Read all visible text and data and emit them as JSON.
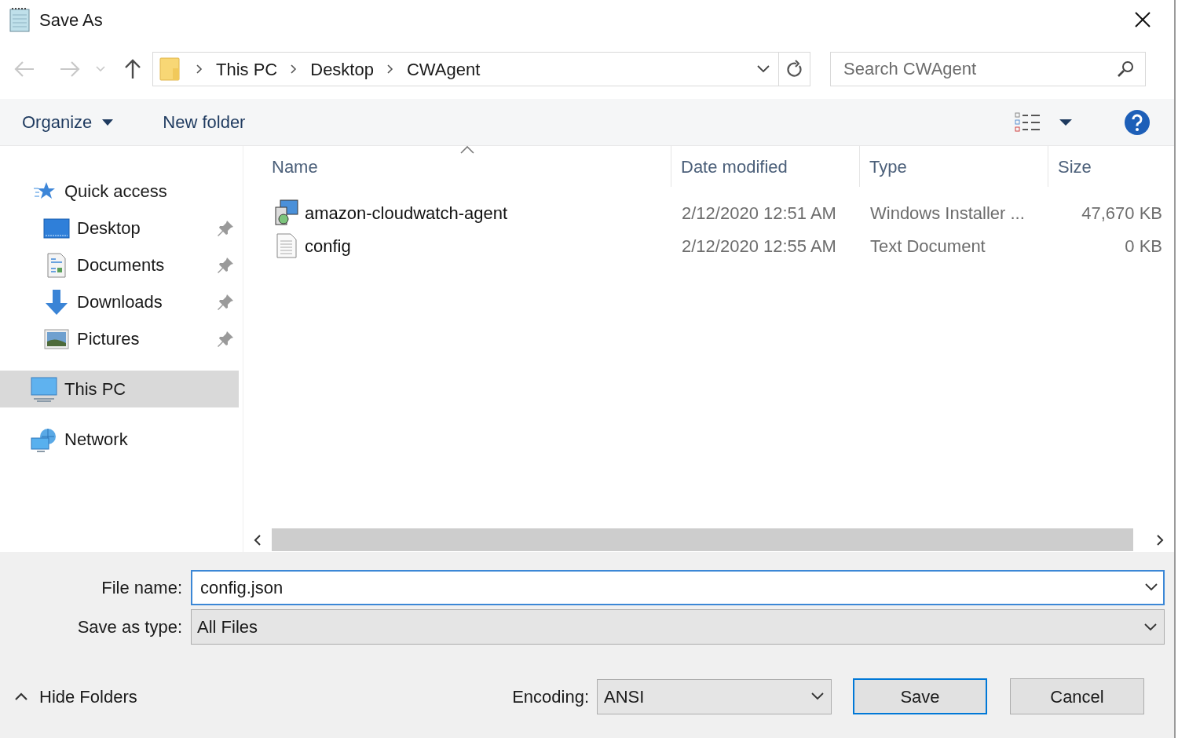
{
  "window": {
    "title": "Save As"
  },
  "nav_buttons": [
    {
      "kind": "back",
      "disabled": true
    },
    {
      "kind": "forward",
      "disabled": true
    },
    {
      "kind": "recent",
      "disabled": true
    },
    {
      "kind": "up",
      "disabled": false
    }
  ],
  "address": {
    "segments": [
      "This PC",
      "Desktop",
      "CWAgent"
    ]
  },
  "search": {
    "placeholder": "Search CWAgent"
  },
  "toolbar": {
    "organize": "Organize",
    "new_folder": "New folder"
  },
  "sidebar": {
    "items": [
      {
        "kind": "star",
        "label": "Quick access",
        "selected": false,
        "children": [
          {
            "kind": "desktop",
            "label": "Desktop",
            "pinned": true,
            "selected": false
          },
          {
            "kind": "documents",
            "label": "Documents",
            "pinned": true,
            "selected": false
          },
          {
            "kind": "downloads",
            "label": "Downloads",
            "pinned": true,
            "selected": false
          },
          {
            "kind": "pictures",
            "label": "Pictures",
            "pinned": true,
            "selected": false
          }
        ]
      },
      {
        "kind": "pc",
        "label": "This PC",
        "selected": true
      },
      {
        "kind": "network",
        "label": "Network",
        "selected": false
      }
    ]
  },
  "table": {
    "columns": [
      {
        "label": "Name",
        "sorted": true
      },
      {
        "label": "Date modified",
        "sorted": false
      },
      {
        "label": "Type",
        "sorted": false
      },
      {
        "label": "Size",
        "sorted": false
      }
    ],
    "rows": [
      {
        "kind": "installer",
        "name": "amazon-cloudwatch-agent",
        "date": "2/12/2020 12:51 AM",
        "type": "Windows Installer ...",
        "size": "47,670 KB"
      },
      {
        "kind": "text",
        "name": "config",
        "date": "2/12/2020 12:55 AM",
        "type": "Text Document",
        "size": "0 KB"
      }
    ]
  },
  "file_name": {
    "label": "File name:",
    "value": "config.json"
  },
  "save_as_type": {
    "label": "Save as type:",
    "value": "All Files"
  },
  "hide_folders": "Hide Folders",
  "encoding": {
    "label": "Encoding:",
    "value": "ANSI"
  },
  "buttons": [
    {
      "label": "Save",
      "default": true
    },
    {
      "label": "Cancel",
      "default": false
    }
  ]
}
